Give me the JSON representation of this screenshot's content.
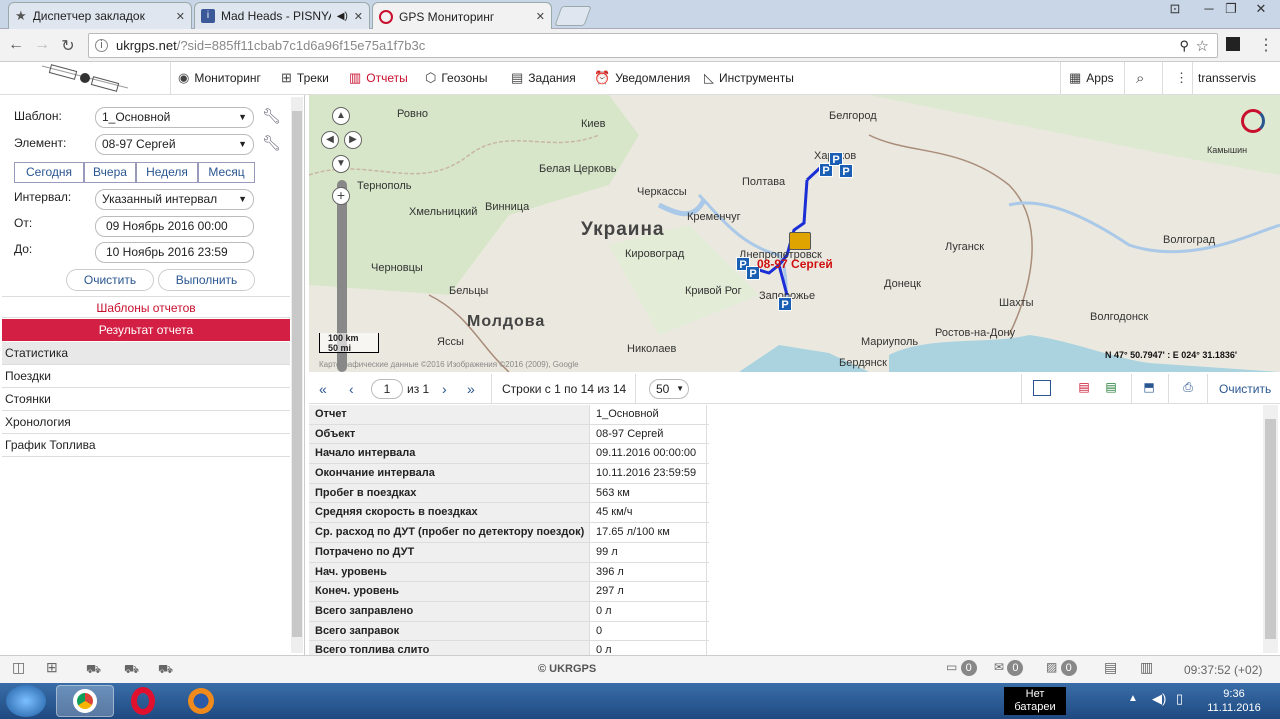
{
  "browser": {
    "tabs": [
      {
        "title": "Диспетчер закладок",
        "icon": "star-icon"
      },
      {
        "title": "Mad Heads - PISNYA",
        "icon": "info-icon"
      },
      {
        "title": "GPS Мониторинг",
        "icon": "ukrgps-logo-icon",
        "active": true
      }
    ],
    "url_host": "ukrgps.net",
    "url_path": "/?sid=885ff11cbab7c1d6a96f15e75a1f7b3c"
  },
  "nav": {
    "items": [
      {
        "label": "Мониторинг",
        "icon": "globe-icon"
      },
      {
        "label": "Треки",
        "icon": "track-icon"
      },
      {
        "label": "Отчеты",
        "icon": "bar-chart-icon",
        "active": true
      },
      {
        "label": "Геозоны",
        "icon": "geozone-icon"
      },
      {
        "label": "Задания",
        "icon": "clipboard-icon"
      },
      {
        "label": "Уведомления",
        "icon": "alarm-clock-icon"
      },
      {
        "label": "Инструменты",
        "icon": "ruler-icon"
      }
    ],
    "apps_label": "Apps",
    "user": "transservis"
  },
  "left": {
    "template_label": "Шаблон:",
    "template_value": "1_Основной",
    "element_label": "Элемент:",
    "element_value": "08-97 Сергей",
    "periods": [
      "Сегодня",
      "Вчера",
      "Неделя",
      "Месяц"
    ],
    "interval_label": "Интервал:",
    "interval_value": "Указанный интервал",
    "from_label": "От:",
    "from_value": "09 Ноябрь 2016 00:00",
    "to_label": "До:",
    "to_value": "10 Ноябрь 2016 23:59",
    "clear_label": "Очистить",
    "run_label": "Выполнить",
    "templates_header": "Шаблоны отчетов",
    "result_header": "Результат отчета",
    "result_items": [
      "Статистика",
      "Поездки",
      "Стоянки",
      "Хронология",
      "График Топлива"
    ]
  },
  "map": {
    "country": "Украина",
    "country2": "Молдова",
    "cities": [
      "Ровно",
      "Киев",
      "Белгород",
      "Харьков",
      "Камышин",
      "Тернополь",
      "Белая Церковь",
      "Полтава",
      "Хмельницкий",
      "Винница",
      "Черкассы",
      "Кременчуг",
      "Днепропетровск",
      "Луганск",
      "Волгоград",
      "Кировоград",
      "Донецк",
      "Черновцы",
      "Кривой Рог",
      "Запорожье",
      "Шахты",
      "Волгодонск",
      "Бельцы",
      "Николаев",
      "Мариуполь",
      "Ростов-на-Дону",
      "Ясcы",
      "Бердянск"
    ],
    "vehicle_label": "08-97 Сергей",
    "coords": "N 47° 50.7947' : E 024° 31.1836'",
    "scale_km": "100 km",
    "scale_mi": "50 mi",
    "copyright": "Картографические данные ©2016 Изображения ©2016 (2009), Google"
  },
  "table_toolbar": {
    "page_value": "1",
    "of_label": "из 1",
    "rows_info": "Строки с 1 по 14 из 14",
    "per_page": "50",
    "clear_label": "Очистить"
  },
  "report": [
    {
      "k": "Отчет",
      "v": "1_Основной"
    },
    {
      "k": "Объект",
      "v": "08-97 Сергей"
    },
    {
      "k": "Начало интервала",
      "v": "09.11.2016 00:00:00"
    },
    {
      "k": "Окончание интервала",
      "v": "10.11.2016 23:59:59"
    },
    {
      "k": "Пробег в поездках",
      "v": "563 км"
    },
    {
      "k": "Средняя скорость в поездках",
      "v": "45 км/ч"
    },
    {
      "k": "Ср. расход по ДУТ (пробег по детектору поездок)",
      "v": "17.65 л/100 км"
    },
    {
      "k": "Потрачено по ДУТ",
      "v": "99 л"
    },
    {
      "k": "Нач. уровень",
      "v": "396 л"
    },
    {
      "k": "Конеч. уровень",
      "v": "297 л"
    },
    {
      "k": "Всего заправлено",
      "v": "0 л"
    },
    {
      "k": "Всего заправок",
      "v": "0"
    },
    {
      "k": "Всего топлива слито",
      "v": "0 л"
    }
  ],
  "status": {
    "brand": "© UKRGPS",
    "counters": [
      "0",
      "0",
      "0"
    ],
    "time": "09:37:52 (+02)"
  },
  "taskbar": {
    "battery": "Нет батареи",
    "clock_time": "9:36",
    "clock_date": "11.11.2016"
  }
}
